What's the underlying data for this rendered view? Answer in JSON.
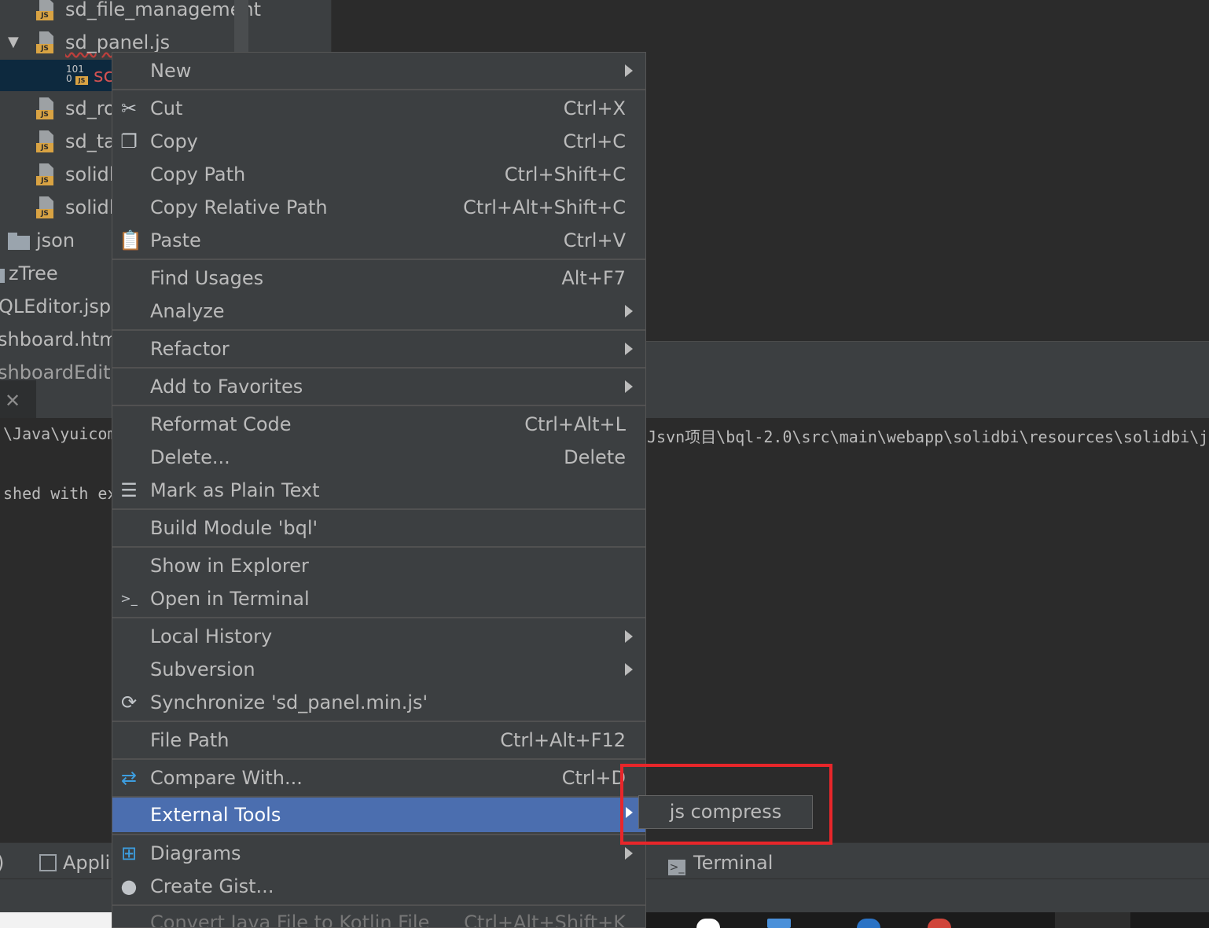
{
  "project_tree": {
    "items": [
      {
        "label": "sd_file_management",
        "icon": "js-file-icon"
      },
      {
        "label": "sd_panel.js",
        "icon": "js-file-icon",
        "expanded": true
      },
      {
        "label": "sc",
        "icon": "minified-js-icon",
        "selected": true
      },
      {
        "label": "sd_ro",
        "icon": "js-file-icon"
      },
      {
        "label": "sd_ta",
        "icon": "js-file-icon"
      },
      {
        "label": "solidl",
        "icon": "js-file-icon"
      },
      {
        "label": "solidl",
        "icon": "js-file-icon"
      },
      {
        "label": "json",
        "icon": "folder-icon"
      },
      {
        "label": "zTree",
        "icon": "folder-icon"
      },
      {
        "label": "QLEditor.jsp",
        "icon": "jsp-file-icon"
      },
      {
        "label": "shboard.htm",
        "icon": "html-file-icon"
      },
      {
        "label": "shboardEdit",
        "icon": "html-file-icon"
      }
    ]
  },
  "console": {
    "line1_left": "\\Java\\yuicom",
    "line1_right": "Jsvn项目\\bql-2.0\\src\\main\\webapp\\solidbi\\resources\\solidbi\\j",
    "line2": "shed with ex"
  },
  "bottom_tools": {
    "left_fragment": ")",
    "application": "Appli",
    "terminal": "Terminal"
  },
  "context_menu": {
    "new": "New",
    "cut": "Cut",
    "cut_sc": "Ctrl+X",
    "copy": "Copy",
    "copy_sc": "Ctrl+C",
    "copy_path": "Copy Path",
    "copy_path_sc": "Ctrl+Shift+C",
    "copy_relative_path": "Copy Relative Path",
    "copy_relative_path_sc": "Ctrl+Alt+Shift+C",
    "paste": "Paste",
    "paste_sc": "Ctrl+V",
    "find_usages": "Find Usages",
    "find_usages_sc": "Alt+F7",
    "analyze": "Analyze",
    "refactor": "Refactor",
    "add_to_favorites": "Add to Favorites",
    "reformat_code": "Reformat Code",
    "reformat_code_sc": "Ctrl+Alt+L",
    "delete": "Delete...",
    "delete_sc": "Delete",
    "mark_plain_text": "Mark as Plain Text",
    "build_module": "Build Module 'bql'",
    "show_in_explorer": "Show in Explorer",
    "open_in_terminal": "Open in Terminal",
    "local_history": "Local History",
    "subversion": "Subversion",
    "synchronize": "Synchronize 'sd_panel.min.js'",
    "file_path": "File Path",
    "file_path_sc": "Ctrl+Alt+F12",
    "compare_with": "Compare With...",
    "compare_with_sc": "Ctrl+D",
    "external_tools": "External Tools",
    "diagrams": "Diagrams",
    "create_gist": "Create Gist...",
    "convert_java": "Convert Java File to Kotlin File",
    "convert_java_sc": "Ctrl+Alt+Shift+K"
  },
  "submenu": {
    "js_compress": "js compress"
  },
  "colors": {
    "highlight": "#4b6eaf",
    "menu_bg": "#3c3f41",
    "editor_bg": "#2b2b2b",
    "annotation_box": "#e8262a"
  }
}
